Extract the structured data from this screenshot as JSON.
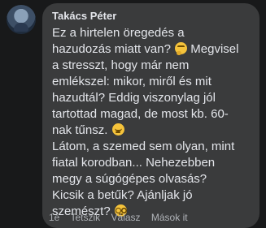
{
  "comment": {
    "author": "Takács Péter",
    "lines": [
      "Ez a hirtelen öregedés a",
      "hazudozás miatt van?",
      "Megvisel",
      "a stresszt, hogy már nem",
      "emlékszel: mikor, miről és mit",
      "hazudtál? Eddig viszonylag jól",
      "tartottad magad, de most kb. 60-",
      "nak tűnsz.",
      "Látom, a szemed sem olyan, mint",
      "fiatal korodban... Nehezebben",
      "megy a súgógépes olvasás?",
      "Kicsik a betűk? Ajánljak jó",
      "szemészt?"
    ],
    "emojis": [
      "thinking-face-icon",
      "relieved-face-icon",
      "nerd-face-icon"
    ]
  },
  "actions": {
    "time": "1é",
    "like": "Tetszik",
    "reply": "Válasz",
    "more": "Mások it"
  },
  "colors": {
    "background": "#18191a",
    "bubble": "#3a3b3c",
    "text": "#e4e6eb",
    "muted": "#b0b3b8"
  }
}
